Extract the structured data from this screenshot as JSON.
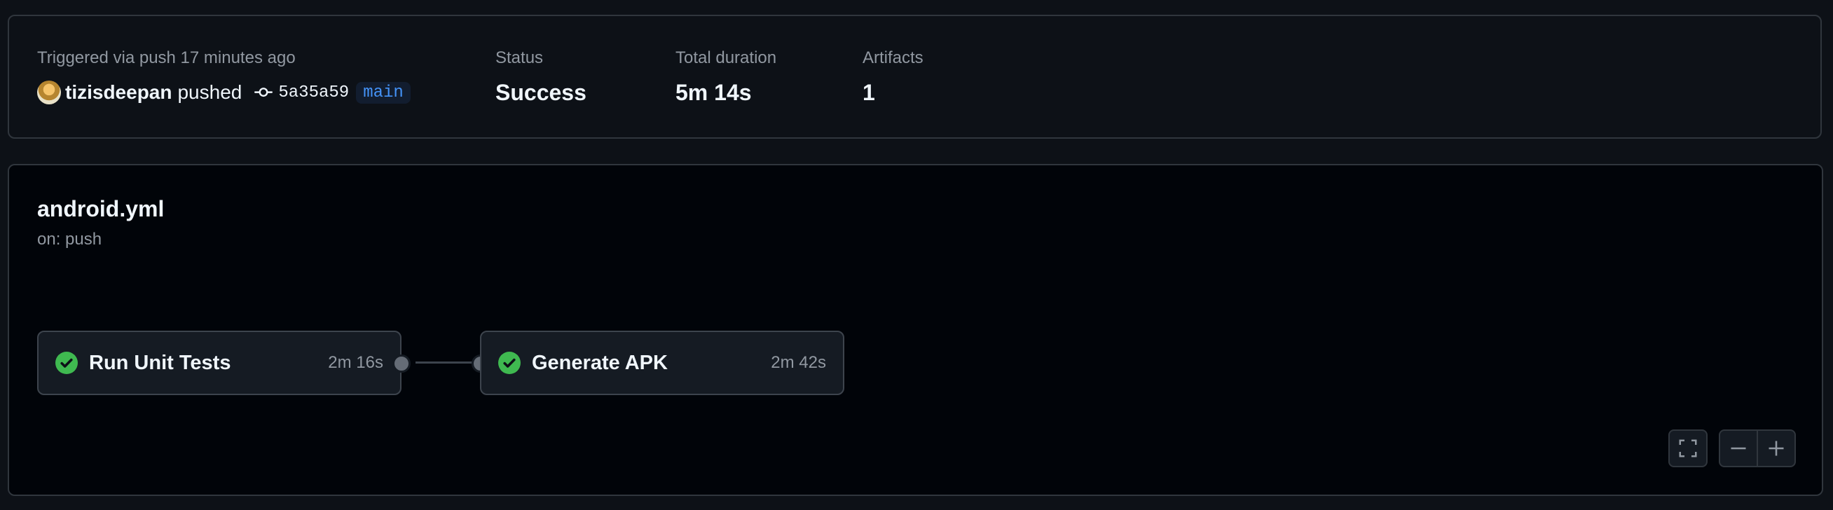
{
  "run": {
    "trigger_text": "Triggered via push 17 minutes ago",
    "actor": "tizisdeepan",
    "action": "pushed",
    "commit_sha": "5a35a59",
    "branch": "main",
    "status_label": "Status",
    "status_value": "Success",
    "duration_label": "Total duration",
    "duration_value": "5m 14s",
    "artifacts_label": "Artifacts",
    "artifacts_value": "1"
  },
  "workflow": {
    "file": "android.yml",
    "trigger": "on: push",
    "jobs": [
      {
        "name": "Run Unit Tests",
        "duration": "2m 16s",
        "status": "success"
      },
      {
        "name": "Generate APK",
        "duration": "2m 42s",
        "status": "success"
      }
    ]
  },
  "controls": {
    "fullscreen_icon": "fullscreen-icon",
    "zoom_out_icon": "zoom-out-icon",
    "zoom_in_icon": "zoom-in-icon"
  },
  "colors": {
    "success": "#3fb950",
    "branch_text": "#4493f8",
    "branch_bg": "#121d2f"
  }
}
